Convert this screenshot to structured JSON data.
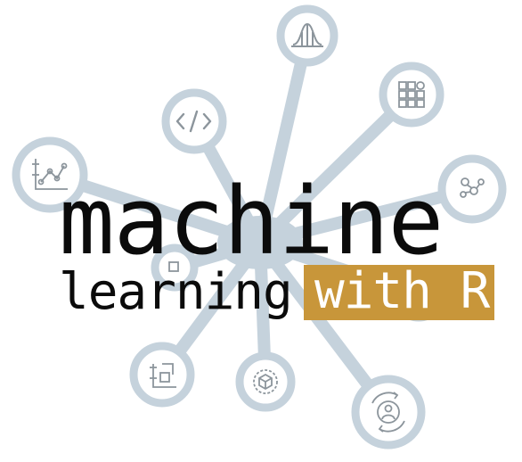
{
  "logo": {
    "title_main": "machine",
    "title_sub": "learning",
    "title_badge": "with R",
    "colors": {
      "network": "#c5d2dc",
      "icon": "#8c959c",
      "text": "#0b0b0b",
      "badge": "#c8963a",
      "badge_text": "#ffffff"
    },
    "nodes": [
      {
        "name": "bell-curve-icon"
      },
      {
        "name": "grid-blocks-icon"
      },
      {
        "name": "code-tag-icon"
      },
      {
        "name": "scatter-plot-icon"
      },
      {
        "name": "molecule-icon"
      },
      {
        "name": "flowchart-icon"
      },
      {
        "name": "layers-icon"
      },
      {
        "name": "gear-cube-icon"
      },
      {
        "name": "user-cycle-icon"
      }
    ]
  }
}
